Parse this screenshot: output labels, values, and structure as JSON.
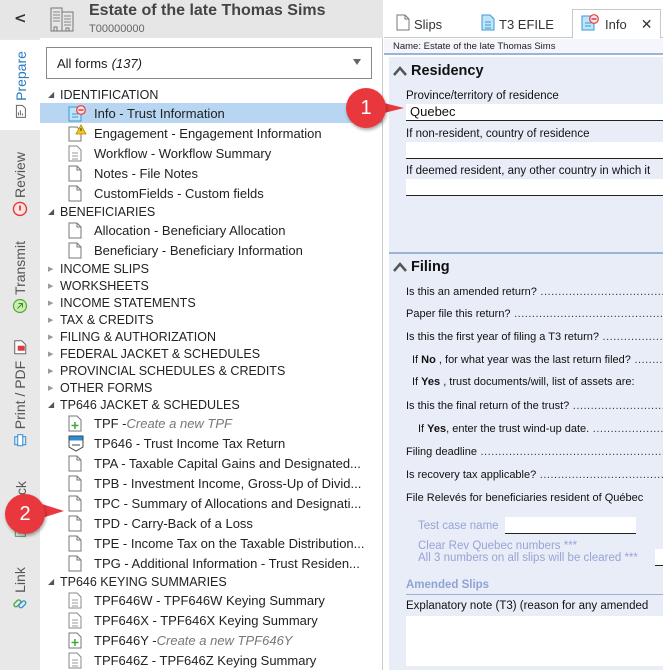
{
  "client": {
    "name": "Estate of the late Thomas Sims",
    "id": "T00000000"
  },
  "side_nav": {
    "collapse_label": "<",
    "tabs": [
      {
        "label": "Prepare",
        "icon": "prepare-icon",
        "active": true
      },
      {
        "label": "Review",
        "icon": "review-alert-icon",
        "active": false
      },
      {
        "label": "Transmit",
        "icon": "transmit-icon",
        "active": false
      },
      {
        "label": "Print / PDF",
        "icon": "print-pdf-icon",
        "active": false
      },
      {
        "label": "Check",
        "icon": "check-icon",
        "active": false
      },
      {
        "label": "Link",
        "icon": "link-icon",
        "active": false
      }
    ]
  },
  "forms_filter": {
    "label": "All forms",
    "count": "(137)"
  },
  "tree": [
    {
      "type": "group",
      "label": "IDENTIFICATION",
      "expanded": true
    },
    {
      "type": "item",
      "label": "Info - Trust Information",
      "icon": "doc-error",
      "selected": true
    },
    {
      "type": "item",
      "label": "Engagement - Engagement Information",
      "icon": "doc-warning"
    },
    {
      "type": "item",
      "label": "Workflow - Workflow Summary",
      "icon": "doc-lines"
    },
    {
      "type": "item",
      "label": "Notes - File Notes",
      "icon": "doc"
    },
    {
      "type": "item",
      "label": "CustomFields - Custom fields",
      "icon": "doc"
    },
    {
      "type": "group",
      "label": "BENEFICIARIES",
      "expanded": true
    },
    {
      "type": "item",
      "label": "Allocation - Beneficiary Allocation",
      "icon": "doc"
    },
    {
      "type": "item",
      "label": "Beneficiary - Beneficiary Information",
      "icon": "doc"
    },
    {
      "type": "group",
      "label": "INCOME SLIPS",
      "expanded": false
    },
    {
      "type": "group",
      "label": "WORKSHEETS",
      "expanded": false
    },
    {
      "type": "group",
      "label": "INCOME STATEMENTS",
      "expanded": false
    },
    {
      "type": "group",
      "label": "TAX & CREDITS",
      "expanded": false
    },
    {
      "type": "group",
      "label": "FILING & AUTHORIZATION",
      "expanded": false
    },
    {
      "type": "group",
      "label": "FEDERAL JACKET & SCHEDULES",
      "expanded": false
    },
    {
      "type": "group",
      "label": "PROVINCIAL SCHEDULES & CREDITS",
      "expanded": false
    },
    {
      "type": "group",
      "label": "OTHER FORMS",
      "expanded": false
    },
    {
      "type": "group",
      "label": "TP646 JACKET & SCHEDULES",
      "expanded": true
    },
    {
      "type": "item",
      "label": "TPF - ",
      "italic": "Create a new TPF",
      "icon": "doc-add"
    },
    {
      "type": "item",
      "label": "TP646 - Trust Income Tax Return",
      "icon": "jacket"
    },
    {
      "type": "item",
      "label": "TPA - Taxable Capital Gains and Designated...",
      "icon": "doc"
    },
    {
      "type": "item",
      "label": "TPB - Investment Income, Gross-Up of Divid...",
      "icon": "doc"
    },
    {
      "type": "item",
      "label": "TPC - Summary of Allocations and Designati...",
      "icon": "doc"
    },
    {
      "type": "item",
      "label": "TPD - Carry-Back of a Loss",
      "icon": "doc"
    },
    {
      "type": "item",
      "label": "TPE - Income Tax on the Taxable Distribution...",
      "icon": "doc"
    },
    {
      "type": "item",
      "label": "TPG - Additional Information - Trust Residen...",
      "icon": "doc"
    },
    {
      "type": "group",
      "label": "TP646 KEYING SUMMARIES",
      "expanded": true
    },
    {
      "type": "item",
      "label": "TPF646W - TPF646W Keying Summary",
      "icon": "doc-lines"
    },
    {
      "type": "item",
      "label": "TPF646X - TPF646X Keying Summary",
      "icon": "doc-lines"
    },
    {
      "type": "item",
      "label": "TPF646Y - ",
      "italic": "Create a new TPF646Y",
      "icon": "doc-add"
    },
    {
      "type": "item",
      "label": "TPF646Z - TPF646Z Keying Summary",
      "icon": "doc-lines"
    }
  ],
  "tabs": [
    {
      "label": "Slips",
      "icon": "doc-icon",
      "active": false
    },
    {
      "label": "T3 EFILE",
      "icon": "doc-lines-icon",
      "active": false
    },
    {
      "label": "Info",
      "icon": "doc-error-icon",
      "active": true,
      "closable": true
    }
  ],
  "name_bar": "Name: Estate of the late Thomas Sims",
  "residency": {
    "title": "Residency",
    "province_label": "Province/territory of residence",
    "province_value": "Quebec",
    "nonresident_label": "If non-resident, country of residence",
    "nonresident_value": "",
    "deemed_label": "If deemed resident, any other country in which it",
    "deemed_value": ""
  },
  "filing": {
    "title": "Filing",
    "questions": [
      {
        "pre": "Is this an amended return?",
        "bold": "",
        "post": "",
        "indent": 0
      },
      {
        "pre": "Paper file this return?",
        "bold": "",
        "post": "",
        "indent": 0
      },
      {
        "pre": "Is this the first year of filing a T3 return?",
        "bold": "",
        "post": "",
        "indent": 0
      },
      {
        "pre": "If ",
        "bold": "No",
        "post": " , for what year was the last return filed?",
        "indent": 1
      },
      {
        "pre": "If ",
        "bold": "Yes",
        "post": " , trust documents/will, list of assets are:",
        "indent": 1,
        "nodots": true
      },
      {
        "pre": "Is this the final return of the trust?",
        "bold": "",
        "post": "",
        "indent": 0
      },
      {
        "pre": "If ",
        "bold": "Yes",
        "post": ", enter the trust wind-up date.",
        "indent": 2
      },
      {
        "pre": "Filing deadline",
        "bold": "",
        "post": "",
        "indent": 0
      },
      {
        "pre": "Is recovery tax applicable?",
        "bold": "",
        "post": "",
        "indent": 0
      },
      {
        "pre": "File Relevés for beneficiaries resident of Québec",
        "bold": "",
        "post": "",
        "indent": 0,
        "nodots": true
      }
    ],
    "test_case_label": "Test case name",
    "test_case_value": "",
    "clear_rev_line1": "Clear Rev Quebec numbers ***",
    "clear_rev_line2": "All 3 numbers on all slips will be cleared ***",
    "amended_slips_title": "Amended Slips",
    "explanatory_label": "Explanatory note (T3) (reason for any amended",
    "explanatory_value": ""
  },
  "callouts": [
    "1",
    "2"
  ],
  "colors": {
    "accent": "#2a7bc0",
    "selected_row": "#b8d6f2",
    "callout": "#e8383d",
    "form_bg": "#e9edf7",
    "muted_text": "#97a4d6"
  }
}
